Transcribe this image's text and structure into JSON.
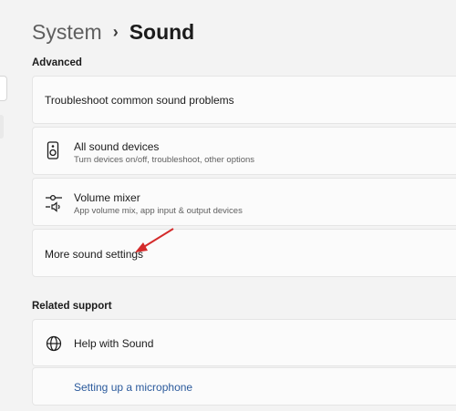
{
  "breadcrumb": {
    "parent": "System",
    "separator": "›",
    "current": "Sound"
  },
  "advanced": {
    "label": "Advanced",
    "items": [
      {
        "title": "Troubleshoot common sound problems"
      },
      {
        "title": "All sound devices",
        "subtitle": "Turn devices on/off, troubleshoot, other options",
        "icon": "speaker-icon"
      },
      {
        "title": "Volume mixer",
        "subtitle": "App volume mix, app input & output devices",
        "icon": "volume-mixer-icon"
      },
      {
        "title": "More sound settings"
      }
    ]
  },
  "related": {
    "label": "Related support",
    "help_title": "Help with Sound",
    "help_icon": "globe-icon",
    "link": "Setting up a microphone"
  },
  "colors": {
    "annotation_arrow": "#d42b2b",
    "link": "#2b5a9c"
  }
}
